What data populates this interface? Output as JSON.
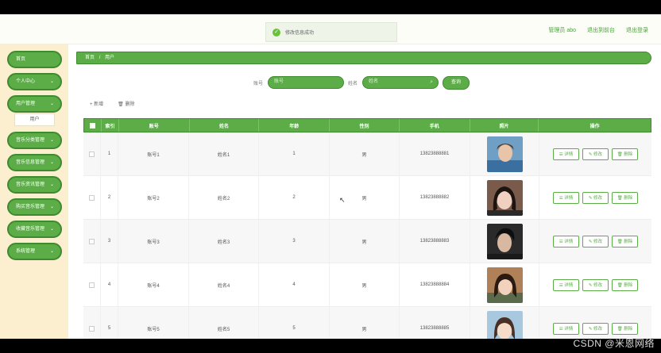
{
  "toast": {
    "message": "修改信息成功"
  },
  "header": {
    "admin_label": "管理员 abo",
    "back_link": "退出到前台",
    "logout_link": "退出登录"
  },
  "sidebar": {
    "items": [
      {
        "label": "首页",
        "has_chevron": false
      },
      {
        "label": "个人中心",
        "has_chevron": true
      },
      {
        "label": "用户管理",
        "has_chevron": true
      },
      {
        "label": "音乐分类管理",
        "has_chevron": true
      },
      {
        "label": "音乐信息管理",
        "has_chevron": true
      },
      {
        "label": "音乐资讯管理",
        "has_chevron": true
      },
      {
        "label": "购买音乐管理",
        "has_chevron": true
      },
      {
        "label": "收藏音乐管理",
        "has_chevron": true
      },
      {
        "label": "系统管理",
        "has_chevron": true
      }
    ],
    "subitem": "用户",
    "chevron": "⌄"
  },
  "breadcrumb": {
    "home": "首页",
    "sep": "/",
    "current": "用户"
  },
  "search": {
    "account_label": "账号",
    "account_placeholder": "账号",
    "name_label": "姓名",
    "name_placeholder": "姓名",
    "query_button": "查询",
    "search_icon": "⌕"
  },
  "toolbar": {
    "add_label": "+ 新增",
    "delete_label": "🗑 删除"
  },
  "table": {
    "headers": [
      "",
      "索引",
      "账号",
      "姓名",
      "年龄",
      "性别",
      "手机",
      "照片",
      "操作"
    ],
    "rows": [
      {
        "index": "1",
        "account": "账号1",
        "name": "姓名1",
        "age": "1",
        "gender": "男",
        "phone": "13823888881"
      },
      {
        "index": "2",
        "account": "账号2",
        "name": "姓名2",
        "age": "2",
        "gender": "男",
        "phone": "13823888882"
      },
      {
        "index": "3",
        "account": "账号3",
        "name": "姓名3",
        "age": "3",
        "gender": "男",
        "phone": "13823888883"
      },
      {
        "index": "4",
        "account": "账号4",
        "name": "姓名4",
        "age": "4",
        "gender": "男",
        "phone": "13823888884"
      },
      {
        "index": "5",
        "account": "账号5",
        "name": "姓名5",
        "age": "5",
        "gender": "男",
        "phone": "13823888885"
      }
    ],
    "actions": {
      "detail": "☰ 详情",
      "edit": "✎ 修改",
      "delete": "🗑 删除"
    }
  },
  "watermark": "CSDN @米恩网络",
  "colors": {
    "primary": "#5cad48",
    "border": "#3e8a2e",
    "sidebar_bg": "#fcefcf"
  }
}
